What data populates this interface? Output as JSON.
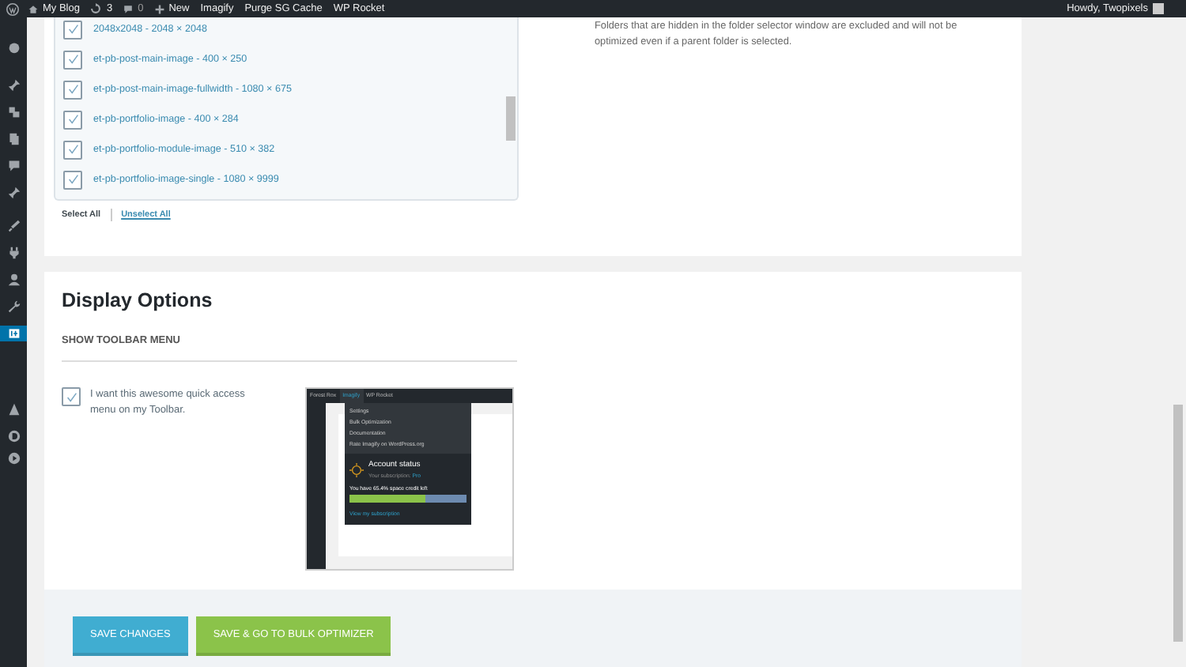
{
  "admin_bar": {
    "site": "My Blog",
    "updates": "3",
    "comments": "0",
    "new": "New",
    "links": [
      "Imagify",
      "Purge SG Cache",
      "WP Rocket"
    ],
    "greeting": "Howdy, Twopixels"
  },
  "sidebar": {
    "items": [
      {
        "selected": false
      },
      {
        "selected": false
      },
      {
        "selected": false
      },
      {
        "selected": false
      },
      {
        "selected": false
      },
      {
        "selected": false
      },
      {
        "selected": false
      },
      {
        "selected": false
      },
      {
        "selected": false
      },
      {
        "selected": false
      },
      {
        "selected": true
      },
      {
        "selected": false
      },
      {
        "selected": false
      },
      {
        "selected": false
      }
    ]
  },
  "sizes": {
    "items": [
      {
        "label": "2048x2048 - 2048 × 2048",
        "checked": true
      },
      {
        "label": "et-pb-post-main-image - 400 × 250",
        "checked": true
      },
      {
        "label": "et-pb-post-main-image-fullwidth - 1080 × 675",
        "checked": true
      },
      {
        "label": "et-pb-portfolio-image - 400 × 284",
        "checked": true
      },
      {
        "label": "et-pb-portfolio-module-image - 510 × 382",
        "checked": true
      },
      {
        "label": "et-pb-portfolio-image-single - 1080 × 9999",
        "checked": true
      }
    ],
    "select_all": "Select All",
    "unselect_all": "Unselect All",
    "note": "Folders that are hidden in the folder selector window are excluded and will not be optimized even if a parent folder is selected."
  },
  "display_options": {
    "title": "Display Options",
    "subtitle": "SHOW TOOLBAR MENU",
    "option": {
      "label": "I want this awesome quick access menu on my Toolbar.",
      "checked": true
    },
    "preview": {
      "bar": [
        "Forest Rox",
        "Imagify",
        "WP Rocket"
      ],
      "menu": [
        "Settings",
        "Bulk Optimization",
        "Documentation",
        "Rate Imagify on WordPress.org"
      ],
      "account_title": "Account status",
      "subscription": "Your subscription:",
      "plan": "Pro",
      "credit": "You have 65.4% space credit left",
      "level": 0.654,
      "link": "View my subscription"
    }
  },
  "buttons": [
    {
      "label": "SAVE CHANGES",
      "kind": "primary"
    },
    {
      "label": "SAVE & GO TO BULK OPTIMIZER",
      "kind": "secondary"
    }
  ]
}
